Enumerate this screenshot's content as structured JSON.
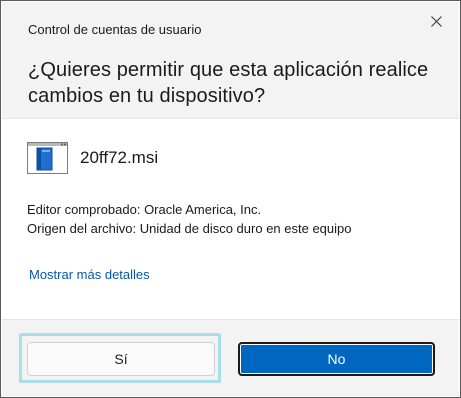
{
  "dialog": {
    "title": "Control de cuentas de usuario",
    "question": "¿Quieres permitir que esta aplicación realice cambios en tu dispositivo?",
    "file_name": "20ff72.msi",
    "file_icon": "installer-package-icon",
    "publisher_line": "Editor comprobado: Oracle America, Inc.",
    "origin_line": "Origen del archivo: Unidad de disco duro en este equipo",
    "details_link": "Mostrar más detalles",
    "yes_label": "Sí",
    "no_label": "No",
    "close_icon": "close-icon"
  },
  "colors": {
    "header_bg": "#f3f3f3",
    "footer_bg": "#f3f3f3",
    "link": "#0558a8",
    "primary_button": "#0067c0",
    "focus_ring": "#a8dfe8"
  }
}
